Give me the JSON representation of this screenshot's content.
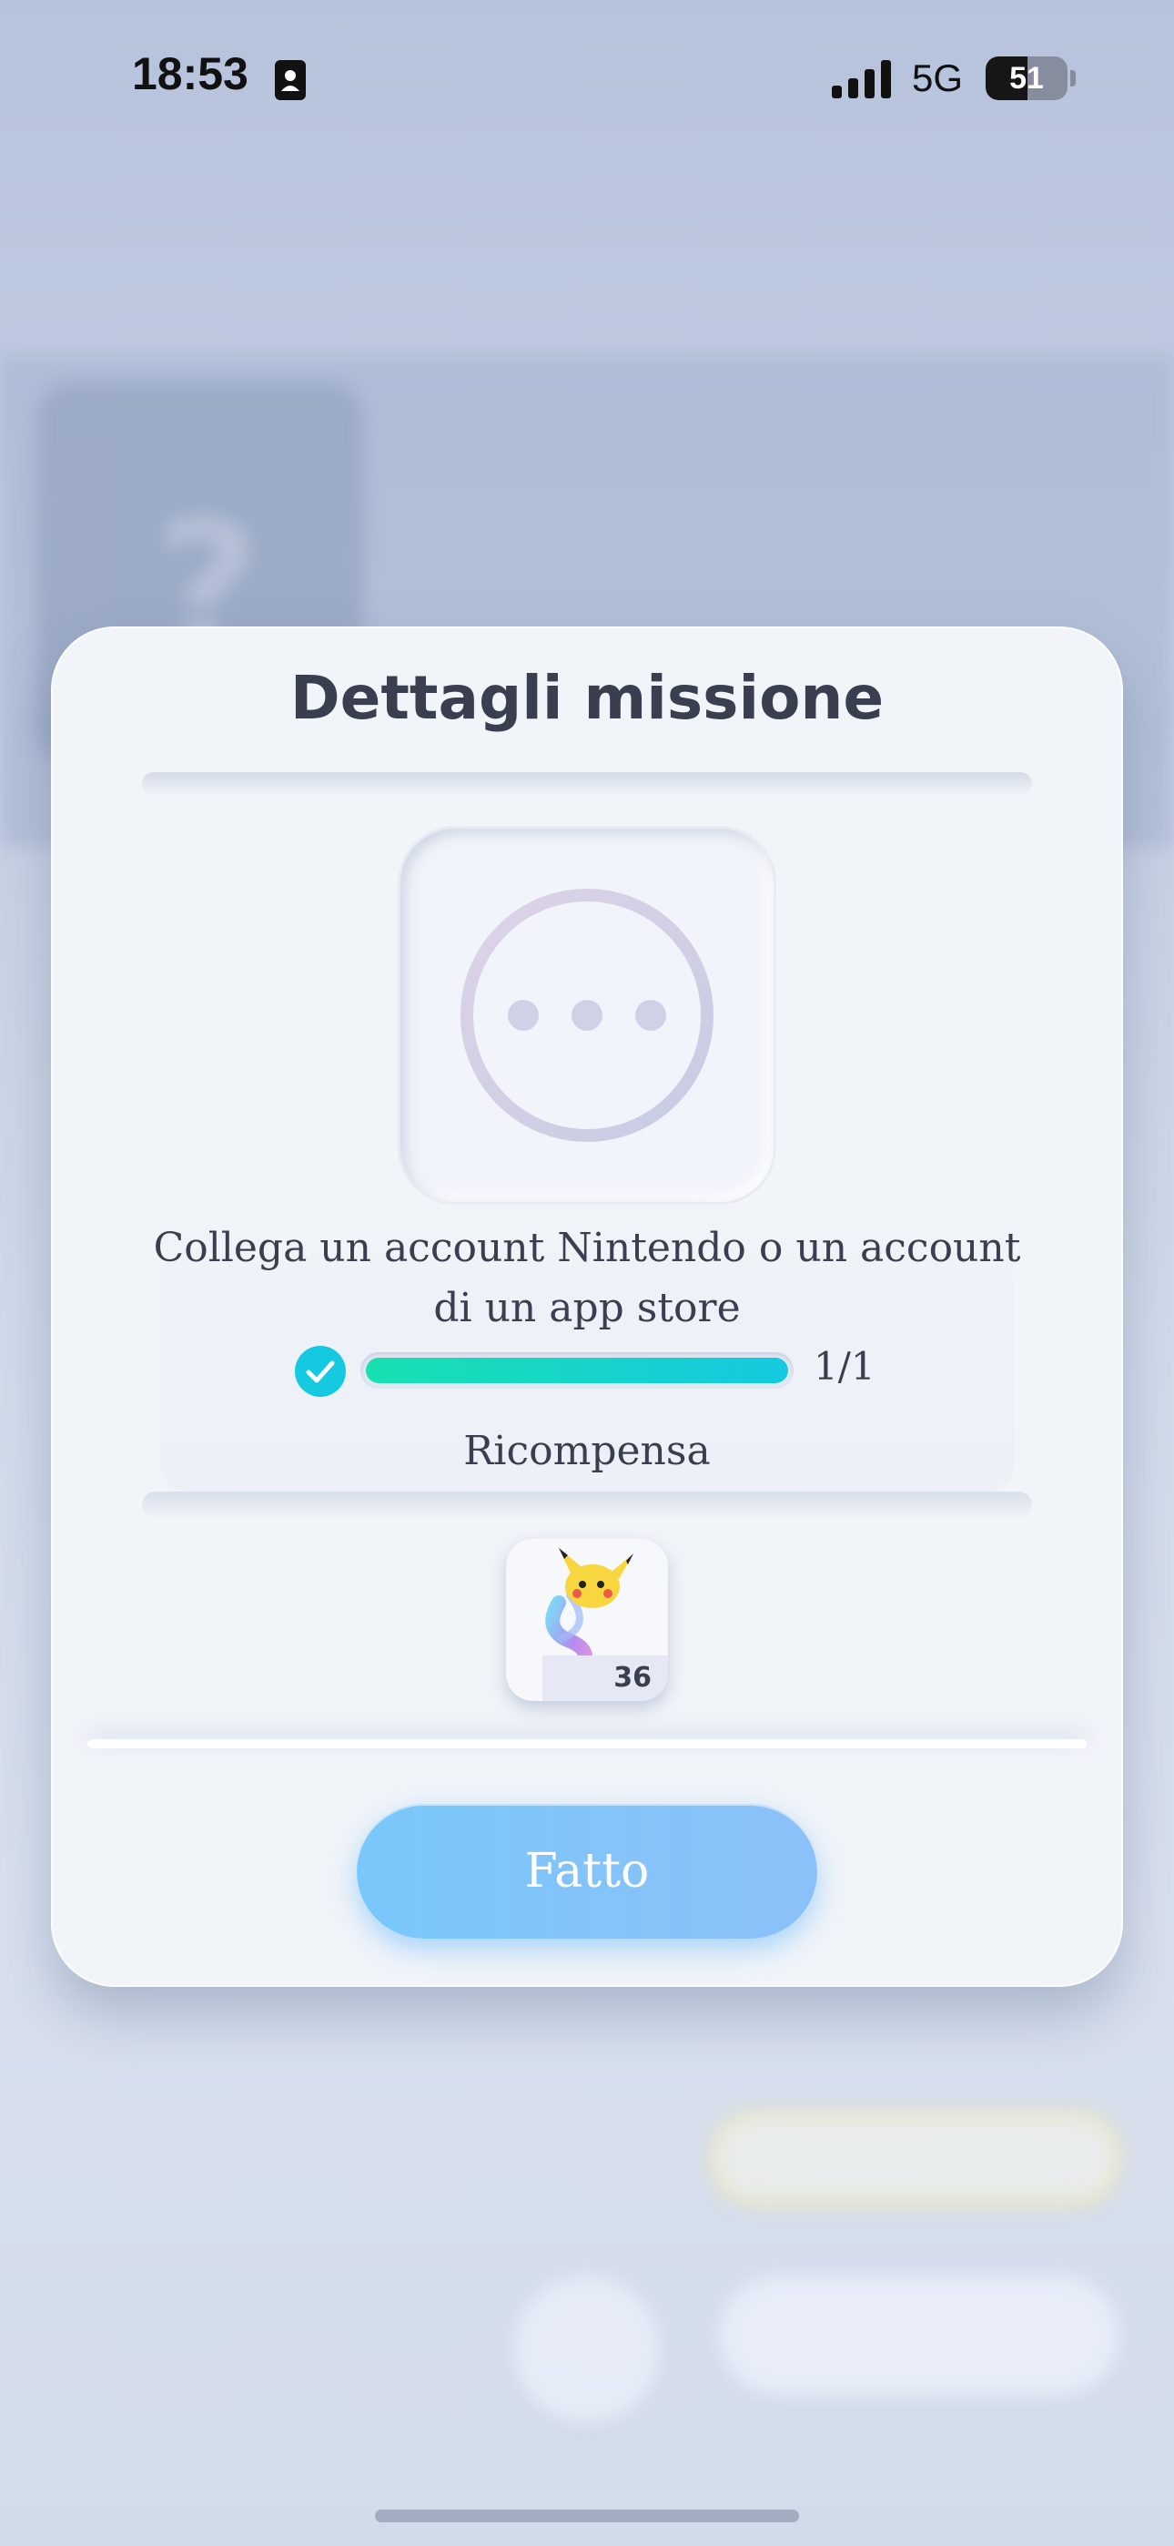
{
  "status_bar": {
    "time": "18:53",
    "network": "5G",
    "battery_level": "51",
    "battery_fraction": 0.51
  },
  "modal": {
    "title": "Dettagli missione",
    "mission_description": "Collega un account Nintendo o un account di un app store",
    "progress": {
      "current": 1,
      "total": 1,
      "label": "1/1",
      "completed": true
    },
    "reward_label": "Ricompensa",
    "reward": {
      "icon": "pikachu-icon",
      "count": "36"
    },
    "done_button_label": "Fatto"
  },
  "colors": {
    "accent_button": "#79c8fb",
    "progress_start": "#18e0b0",
    "progress_end": "#14c9e0",
    "check_fill": "#14c9e0",
    "text_primary": "#3a3f4f"
  }
}
